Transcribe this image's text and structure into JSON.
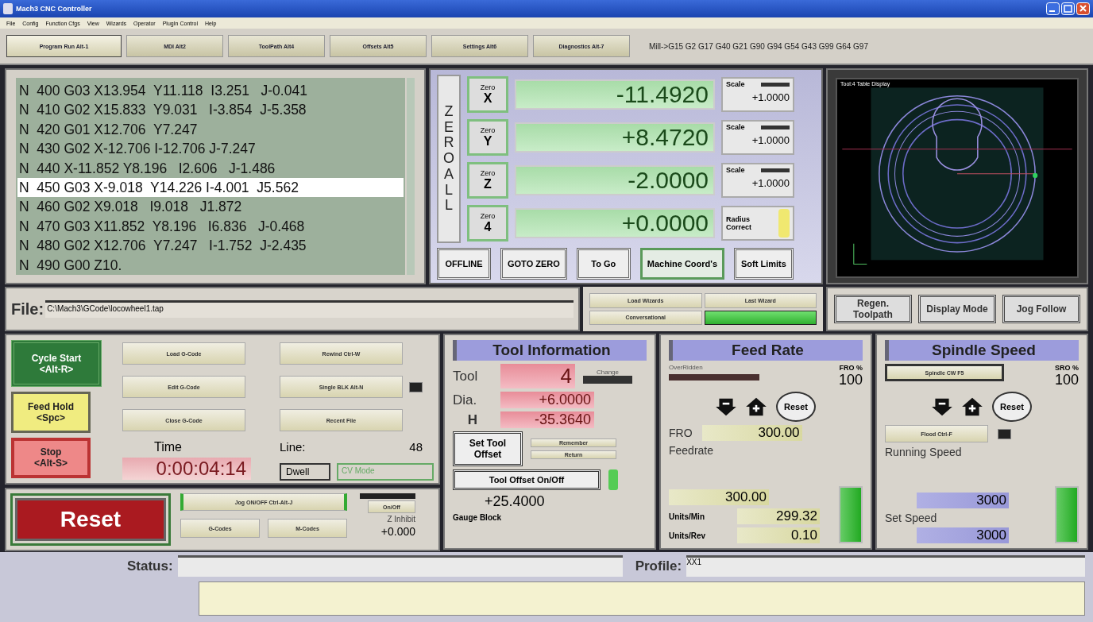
{
  "window": {
    "title": "Mach3 CNC Controller"
  },
  "menu": [
    "File",
    "Config",
    "Function Cfgs",
    "View",
    "Wizards",
    "Operator",
    "PlugIn Control",
    "Help"
  ],
  "tabs": [
    {
      "label": "Program Run Alt-1",
      "selected": true
    },
    {
      "label": "MDI Alt2",
      "selected": false
    },
    {
      "label": "ToolPath Alt4",
      "selected": false
    },
    {
      "label": "Offsets Alt5",
      "selected": false
    },
    {
      "label": "Settings Alt6",
      "selected": false
    },
    {
      "label": "Diagnostics Alt-7",
      "selected": false
    }
  ],
  "modal_line": "Mill->G15  G2 G17 G40 G21 G90 G94 G54 G43 G99 G64 G97",
  "gcode": {
    "lines": [
      {
        "text": "N  400 G03 X13.954  Y11.118  I3.251   J-0.041",
        "selected": false
      },
      {
        "text": "N  410 G02 X15.833  Y9.031   I-3.854  J-5.358",
        "selected": false
      },
      {
        "text": "N  420 G01 X12.706  Y7.247",
        "selected": false
      },
      {
        "text": "N  430 G02 X-12.706 I-12.706 J-7.247",
        "selected": false
      },
      {
        "text": "N  440 X-11.852 Y8.196   I2.606   J-1.486",
        "selected": false
      },
      {
        "text": "N  450 G03 X-9.018  Y14.226 I-4.001  J5.562",
        "selected": true
      },
      {
        "text": "N  460 G02 X9.018   I9.018   J1.872",
        "selected": false
      },
      {
        "text": "N  470 G03 X11.852  Y8.196   I6.836   J-0.468",
        "selected": false
      },
      {
        "text": "N  480 G02 X12.706  Y7.247   I-1.752  J-2.435",
        "selected": false
      },
      {
        "text": "N  490 G00 Z10.",
        "selected": false
      }
    ]
  },
  "zero_all": "ZERO ALL",
  "axes": [
    {
      "kind": "scale",
      "zero": "Zero",
      "axis": "X",
      "value": "-11.4920",
      "label": "Scale",
      "scale": "+1.0000"
    },
    {
      "kind": "scale",
      "zero": "Zero",
      "axis": "Y",
      "value": "+8.4720",
      "label": "Scale",
      "scale": "+1.0000"
    },
    {
      "kind": "scale",
      "zero": "Zero",
      "axis": "Z",
      "value": "-2.0000",
      "label": "Scale",
      "scale": "+1.0000"
    },
    {
      "kind": "radius",
      "zero": "Zero",
      "axis": "4",
      "value": "+0.0000",
      "label": "Radius Correct",
      "on": true
    }
  ],
  "dro_buttons": [
    {
      "label": "OFFLINE",
      "active": false
    },
    {
      "label": "GOTO ZERO",
      "active": false
    },
    {
      "label": "To Go",
      "active": false
    },
    {
      "label": "Machine Coord's",
      "active": true
    },
    {
      "label": "Soft Limits",
      "active": false
    }
  ],
  "toolpath": {
    "title": "Tool:4   Table Display"
  },
  "file": {
    "label": "File:",
    "path": "C:\\Mach3\\GCode\\locowheel1.tap"
  },
  "wizard_buttons": [
    {
      "label": "Load Wizards",
      "on": false
    },
    {
      "label": "Last Wizard",
      "on": false
    },
    {
      "label": "Conversational",
      "on": false
    },
    {
      "on": true
    }
  ],
  "view_buttons": [
    "Regen. Toolpath",
    "Display Mode",
    "Jog Follow"
  ],
  "run_controls": [
    {
      "kind": "start",
      "label": "Cycle Start",
      "key": "<Alt-R>"
    },
    {
      "kind": "hold",
      "label": "Feed Hold",
      "key": "<Spc>"
    },
    {
      "kind": "stop",
      "label": "Stop",
      "key": "<Alt-S>"
    }
  ],
  "program_buttons": [
    {
      "label": "Load G-Code"
    },
    {
      "label": "Rewind Ctrl-W"
    },
    {
      "label": "Edit G-Code"
    },
    {
      "label": "Single BLK Alt-N",
      "led_on": false
    },
    {
      "label": "Close G-Code"
    },
    {
      "label": "Recent File"
    }
  ],
  "time": {
    "label": "Time",
    "value": "0:00:04:14"
  },
  "line": {
    "label": "Line:",
    "value": "48"
  },
  "dwell": "Dwell",
  "cv_mode": "CV Mode",
  "reset": "Reset",
  "jog": {
    "toggle": "Jog ON/OFF Ctrl-Alt-J",
    "gcodes": "G-Codes",
    "mcodes": "M-Codes",
    "onoff": "On/Off",
    "inhibit": "Z Inhibit",
    "inhibit_value": "+0.000"
  },
  "tool_info": {
    "title": "Tool Information",
    "tool_label": "Tool",
    "tool": "4",
    "change": "Change",
    "dia_label": "Dia.",
    "dia": "+6.0000",
    "h_label": "H",
    "h": "-35.3640",
    "set_offset": "Set Tool Offset",
    "remember": "Remember",
    "return": "Return",
    "offset_toggle": "Tool Offset On/Off",
    "offset_on": true,
    "gauge": "+25.4000",
    "gauge_label": "Gauge Block"
  },
  "feed_rate": {
    "title": "Feed Rate",
    "overridden": "OverRidden",
    "pct_label": "FRO %",
    "pct": "100",
    "reset": "Reset",
    "fro_label": "FRO",
    "fro": "300.00",
    "feedrate_label": "Feedrate",
    "feedrate": "300.00",
    "min_label": "Units/Min",
    "units_min": "299.32",
    "rev_label": "Units/Rev",
    "units_rev": "0.10",
    "level": 1
  },
  "spindle": {
    "title": "Spindle Speed",
    "cw": "Spindle CW F5",
    "pct_label": "SRO %",
    "pct": "100",
    "reset": "Reset",
    "flood": "Flood Ctrl-F",
    "flood_on": false,
    "running_label": "Running Speed",
    "running": "3000",
    "set_label": "Set  Speed",
    "set": "3000",
    "level": 1
  },
  "status": {
    "label": "Status:",
    "profile_label": "Profile:",
    "profile": "XX1"
  }
}
